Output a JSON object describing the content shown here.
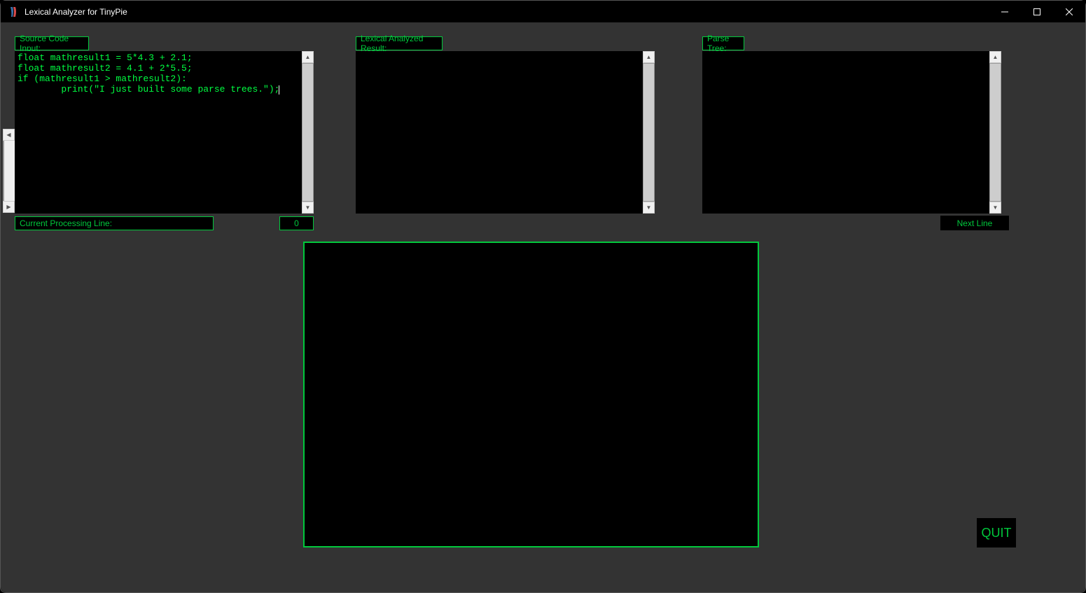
{
  "window": {
    "title": "Lexical Analyzer for TinyPie"
  },
  "labels": {
    "source_input": "Source Code Input:",
    "lexical_result": "Lexical Analyzed Result:",
    "parse_tree": "Parse Tree:",
    "processing_line": "Current Processing Line:"
  },
  "source_code": "float mathresult1 = 5*4.3 + 2.1;\nfloat mathresult2 = 4.1 + 2*5.5;\nif (mathresult1 > mathresult2):\n        print(\"I just built some parse trees.\");",
  "lexical_output": "",
  "parse_output": "",
  "line_counter": "0",
  "buttons": {
    "next_line": "Next   Line",
    "quit": "QUIT"
  },
  "colors": {
    "accent": "#00c83c",
    "text_green": "#00ff41",
    "bg_inner": "#333333",
    "bg_black": "#000000"
  }
}
